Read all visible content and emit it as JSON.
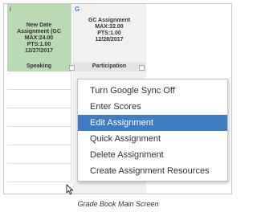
{
  "columns": [
    {
      "marker": "i",
      "lines": [
        "New Date",
        "Assignment (GC",
        "MAX:24.00",
        "PTS:1.00",
        "12/27/2017"
      ],
      "category": "Speaking",
      "header_color": "#b9dab3"
    },
    {
      "marker": "G",
      "lines": [
        "GC Assignment",
        "MAX:32.00",
        "PTS:1.00",
        "12/28/2017"
      ],
      "category": "Participation",
      "header_color": "#f1f1f1"
    }
  ],
  "context_menu": {
    "items": [
      "Turn Google Sync Off",
      "Enter Scores",
      "Edit Assignment",
      "Quick Assignment",
      "Delete Assignment",
      "Create Assignment Resources"
    ],
    "active_item": "Edit Assignment",
    "highlight_color": "#3e7cc4"
  },
  "caption": "Grade Book Main Screen"
}
